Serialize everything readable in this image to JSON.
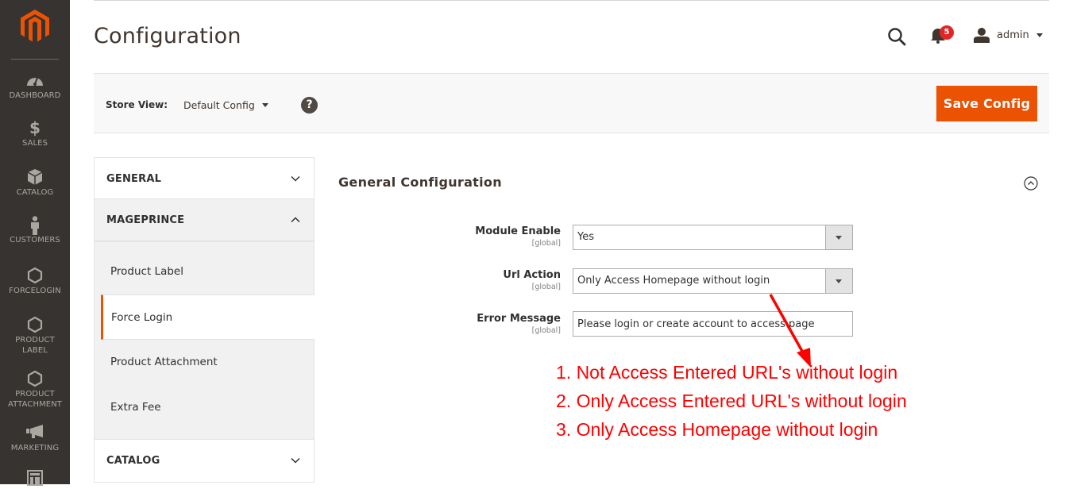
{
  "menu": {
    "items": [
      {
        "label": "DASHBOARD",
        "icon": "dashboard-icon"
      },
      {
        "label": "SALES",
        "icon": "dollar-icon"
      },
      {
        "label": "CATALOG",
        "icon": "box-icon"
      },
      {
        "label": "CUSTOMERS",
        "icon": "person-icon"
      },
      {
        "label": "FORCELOGIN",
        "icon": "hexagon-icon"
      },
      {
        "label": "PRODUCT LABEL",
        "icon": "hexagon-icon"
      },
      {
        "label": "PRODUCT ATTACHMENT",
        "icon": "hexagon-icon"
      },
      {
        "label": "MARKETING",
        "icon": "megaphone-icon"
      }
    ]
  },
  "header": {
    "title": "Configuration",
    "notifications_count": "5",
    "user": "admin"
  },
  "store": {
    "label": "Store View:",
    "value": "Default Config",
    "save_label": "Save Config"
  },
  "tabs": {
    "general": "GENERAL",
    "mageprince": "MAGEPRINCE",
    "mageprince_items": [
      "Product Label",
      "Force Login",
      "Product Attachment",
      "Extra Fee"
    ],
    "active_item": "Force Login",
    "catalog": "CATALOG"
  },
  "section": {
    "title": "General Configuration",
    "fields": [
      {
        "label": "Module Enable",
        "scope": "[global]",
        "value": "Yes",
        "type": "select"
      },
      {
        "label": "Url Action",
        "scope": "[global]",
        "value": "Only Access Homepage without login",
        "type": "select"
      },
      {
        "label": "Error Message",
        "scope": "[global]",
        "value": "Please login or create account to access page",
        "type": "text"
      }
    ]
  },
  "annotation": {
    "color": "#ff0000",
    "lines": [
      "1. Not Access Entered URL's without login",
      "2. Only Access Entered URL's without login",
      "3. Only Access Homepage without login"
    ]
  },
  "colors": {
    "accent": "#eb5202",
    "menu_bg": "#373330"
  }
}
